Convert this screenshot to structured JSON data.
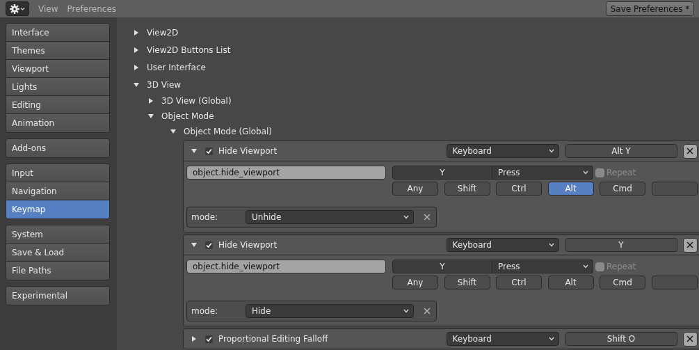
{
  "header": {
    "menu": [
      {
        "label": "View"
      },
      {
        "label": "Preferences"
      }
    ],
    "save_button": "Save Preferences *"
  },
  "sidebar": {
    "groups": [
      [
        {
          "label": "Interface",
          "selected": false
        },
        {
          "label": "Themes",
          "selected": false
        },
        {
          "label": "Viewport",
          "selected": false
        },
        {
          "label": "Lights",
          "selected": false
        },
        {
          "label": "Editing",
          "selected": false
        },
        {
          "label": "Animation",
          "selected": false
        }
      ],
      [
        {
          "label": "Add-ons",
          "selected": false
        }
      ],
      [
        {
          "label": "Input",
          "selected": false
        },
        {
          "label": "Navigation",
          "selected": false
        },
        {
          "label": "Keymap",
          "selected": true
        }
      ],
      [
        {
          "label": "System",
          "selected": false
        },
        {
          "label": "Save & Load",
          "selected": false
        },
        {
          "label": "File Paths",
          "selected": false
        }
      ],
      [
        {
          "label": "Experimental",
          "selected": false
        }
      ]
    ]
  },
  "tree": [
    {
      "label": "View2D",
      "expanded": false
    },
    {
      "label": "View2D Buttons List",
      "expanded": false
    },
    {
      "label": "User Interface",
      "expanded": false
    },
    {
      "label": "3D View",
      "expanded": true,
      "children": [
        {
          "label": "3D View (Global)",
          "expanded": false
        },
        {
          "label": "Object Mode",
          "expanded": true,
          "children": [
            {
              "label": "Object Mode (Global)",
              "expanded": true
            }
          ]
        }
      ]
    }
  ],
  "keymap_items": [
    {
      "name": "Hide Viewport",
      "active": true,
      "expanded": true,
      "input_type": "Keyboard",
      "shortcut": "Alt Y",
      "operator": "object.hide_viewport",
      "key": "Y",
      "event": "Press",
      "repeat": false,
      "repeat_label": "Repeat",
      "modifiers": [
        {
          "label": "Any",
          "on": false
        },
        {
          "label": "Shift",
          "on": false
        },
        {
          "label": "Ctrl",
          "on": false
        },
        {
          "label": "Alt",
          "on": true
        },
        {
          "label": "Cmd",
          "on": false
        }
      ],
      "properties": [
        {
          "label": "mode:",
          "value": "Unhide"
        }
      ]
    },
    {
      "name": "Hide Viewport",
      "active": true,
      "expanded": true,
      "input_type": "Keyboard",
      "shortcut": "Y",
      "operator": "object.hide_viewport",
      "key": "Y",
      "event": "Press",
      "repeat": false,
      "repeat_label": "Repeat",
      "modifiers": [
        {
          "label": "Any",
          "on": false
        },
        {
          "label": "Shift",
          "on": false
        },
        {
          "label": "Ctrl",
          "on": false
        },
        {
          "label": "Alt",
          "on": false
        },
        {
          "label": "Cmd",
          "on": false
        }
      ],
      "properties": [
        {
          "label": "mode:",
          "value": "Hide"
        }
      ]
    },
    {
      "name": "Proportional Editing Falloff",
      "active": true,
      "expanded": false,
      "input_type": "Keyboard",
      "shortcut": "Shift O"
    }
  ]
}
